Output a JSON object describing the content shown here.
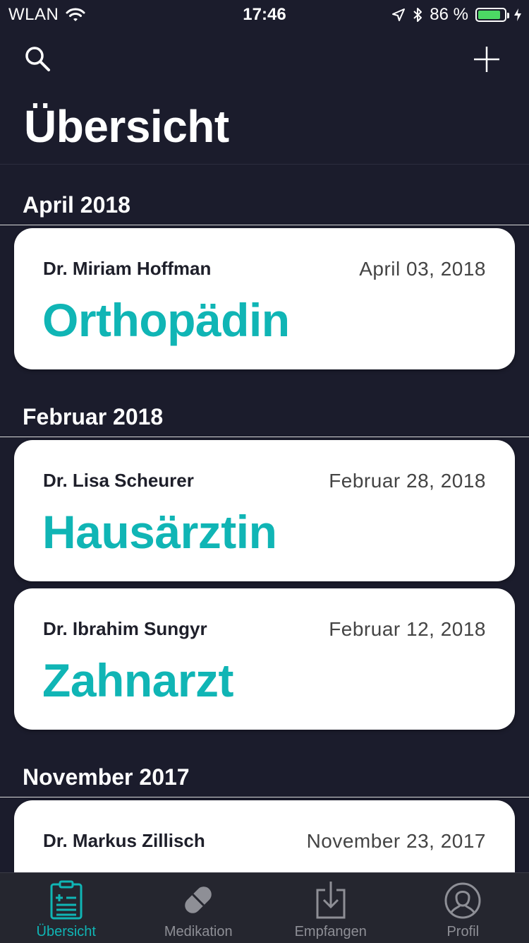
{
  "status_bar": {
    "carrier": "WLAN",
    "time": "17:46",
    "battery_percent": "86 %",
    "battery_level": 0.86,
    "wifi_icon": "wifi-icon",
    "location_icon": "location-arrow-icon",
    "bluetooth_icon": "bluetooth-icon",
    "charging_icon": "charging-bolt-icon"
  },
  "header": {
    "title": "Übersicht",
    "search_icon": "search-icon",
    "add_icon": "plus-icon"
  },
  "sections": [
    {
      "header": "April 2018",
      "items": [
        {
          "doctor": "Dr. Miriam Hoffman",
          "date": "April 03, 2018",
          "specialty": "Orthopädin"
        }
      ]
    },
    {
      "header": "Februar 2018",
      "items": [
        {
          "doctor": "Dr. Lisa Scheurer",
          "date": "Februar 28, 2018",
          "specialty": "Hausärztin"
        },
        {
          "doctor": "Dr. Ibrahim Sungyr",
          "date": "Februar 12, 2018",
          "specialty": "Zahnarzt"
        }
      ]
    },
    {
      "header": "November 2017",
      "items": [
        {
          "doctor": "Dr. Markus Zillisch",
          "date": "November 23, 2017",
          "specialty": ""
        }
      ]
    }
  ],
  "tabbar": {
    "tabs": [
      {
        "label": "Übersicht",
        "icon": "clipboard-icon",
        "active": true
      },
      {
        "label": "Medikation",
        "icon": "pill-icon",
        "active": false
      },
      {
        "label": "Empfangen",
        "icon": "inbox-download-icon",
        "active": false
      },
      {
        "label": "Profil",
        "icon": "person-icon",
        "active": false
      }
    ]
  },
  "colors": {
    "background": "#1b1c2c",
    "accent": "#10b5b5",
    "card": "#ffffff",
    "tabbar": "#25262f"
  }
}
